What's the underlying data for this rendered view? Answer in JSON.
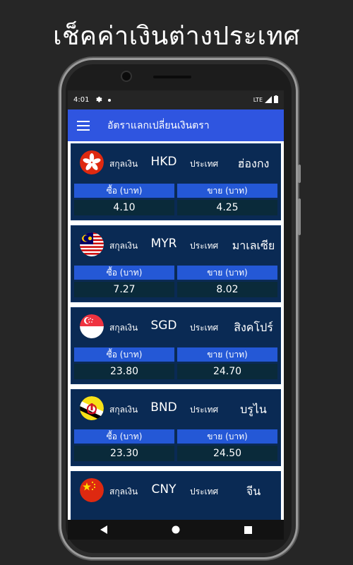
{
  "promo": {
    "headline": "เช็คค่าเงินต่างประเทศ"
  },
  "status_bar": {
    "time": "4:01",
    "network": "LTE",
    "icons": [
      "settings-icon",
      "notification-dot-icon",
      "signal-icon",
      "battery-icon"
    ]
  },
  "app_bar": {
    "title": "อัตราแลกเปลี่ยนเงินตรา",
    "menu_icon": "hamburger-menu-icon"
  },
  "labels": {
    "currency": "สกุลเงิน",
    "country": "ประเทศ",
    "buy": "ซื้อ (บาท)",
    "sell": "ขาย (บาท)"
  },
  "rates": [
    {
      "code": "HKD",
      "country": "ฮ่องกง",
      "buy": "4.10",
      "sell": "4.25",
      "flag": "hong-kong-flag-icon"
    },
    {
      "code": "MYR",
      "country": "มาเลเซีย",
      "buy": "7.27",
      "sell": "8.02",
      "flag": "malaysia-flag-icon"
    },
    {
      "code": "SGD",
      "country": "สิงคโปร์",
      "buy": "23.80",
      "sell": "24.70",
      "flag": "singapore-flag-icon"
    },
    {
      "code": "BND",
      "country": "บรูไน",
      "buy": "23.30",
      "sell": "24.50",
      "flag": "brunei-flag-icon"
    },
    {
      "code": "CNY",
      "country": "จีน",
      "flag": "china-flag-icon"
    }
  ],
  "nav_bar": {
    "icons": [
      "back-icon",
      "home-icon",
      "recents-icon"
    ]
  },
  "colors": {
    "background": "#262626",
    "app_bar": "#2f55e0",
    "card": "#0a2a54",
    "header_cell": "#2458d6",
    "value_cell": "#0a2a3a"
  }
}
